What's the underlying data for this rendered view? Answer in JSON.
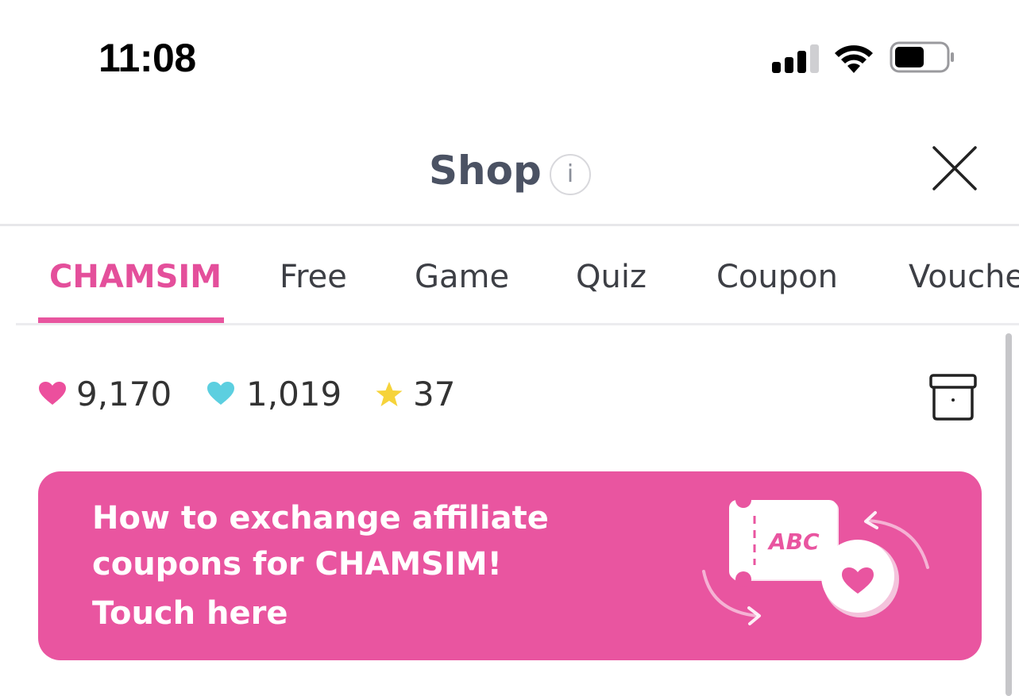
{
  "status_bar": {
    "time": "11:08",
    "icons": [
      "signal-icon",
      "wifi-icon",
      "battery-icon"
    ]
  },
  "header": {
    "title": "Shop",
    "info_icon": "i",
    "close_icon": "close-icon"
  },
  "tabs": [
    {
      "label": "CHAMSIM",
      "active": true
    },
    {
      "label": "Free",
      "active": false
    },
    {
      "label": "Game",
      "active": false
    },
    {
      "label": "Quiz",
      "active": false
    },
    {
      "label": "Coupon",
      "active": false
    },
    {
      "label": "Vouche",
      "active": false
    }
  ],
  "stats": {
    "pink_hearts": "9,170",
    "blue_hearts": "1,019",
    "stars": "37"
  },
  "banner": {
    "line1": "How to exchange affiliate",
    "line2": "coupons for CHAMSIM!",
    "line3": "Touch here",
    "ticket_text": "ABC"
  },
  "colors": {
    "accent_pink": "#e955a0",
    "tab_active": "#e44f9b",
    "heart_pink": "#ec4f9d",
    "heart_blue": "#5ccfe0",
    "star_yellow": "#f6d33a",
    "title_gray": "#4b5263"
  }
}
